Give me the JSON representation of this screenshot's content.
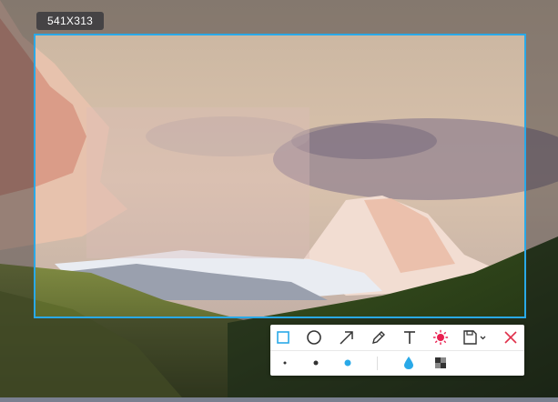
{
  "selection": {
    "size_label": "541X313"
  },
  "toolbar": {
    "tools": [
      {
        "name": "rectangle-tool",
        "icon": "rectangle-icon",
        "active": true
      },
      {
        "name": "ellipse-tool",
        "icon": "circle-icon"
      },
      {
        "name": "arrow-tool",
        "icon": "arrow-icon"
      },
      {
        "name": "pencil-tool",
        "icon": "pencil-icon"
      },
      {
        "name": "text-tool",
        "icon": "text-icon"
      },
      {
        "name": "color-tool",
        "icon": "color-picker-icon"
      },
      {
        "name": "save-tool",
        "icon": "save-icon"
      },
      {
        "name": "close-tool",
        "icon": "close-icon"
      }
    ],
    "brush_sizes": [
      "small",
      "medium",
      "large"
    ],
    "selected_brush": "large",
    "colors": {
      "accent": "#29a9e8",
      "close": "#e0304a",
      "color_dot": "#e91e4f"
    }
  }
}
